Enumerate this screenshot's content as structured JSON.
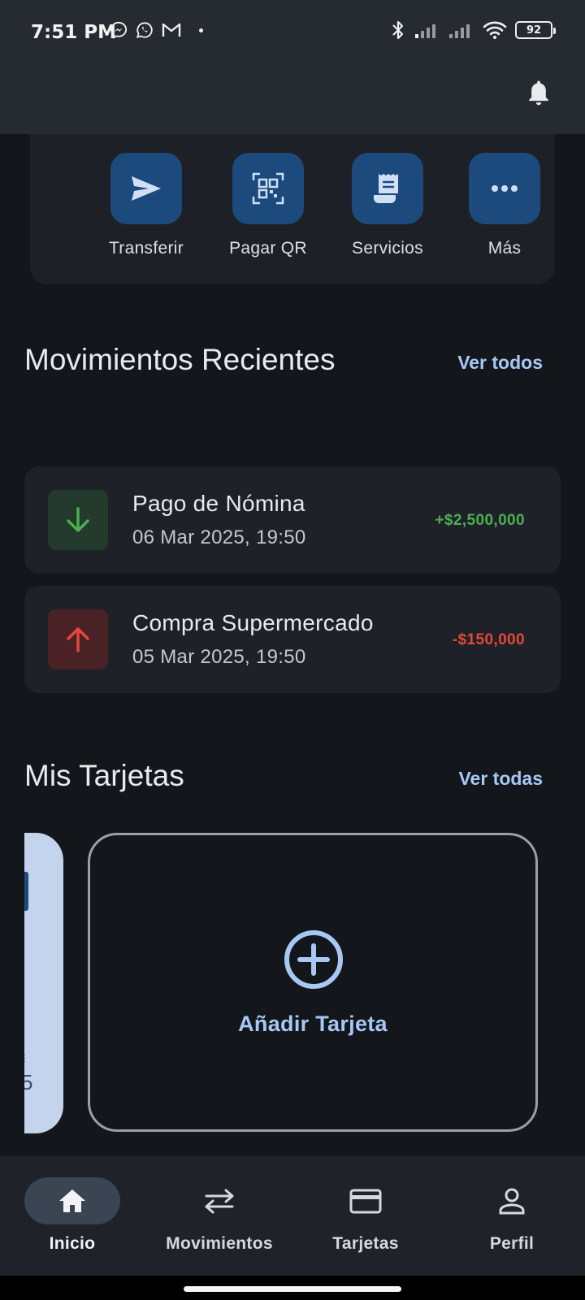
{
  "status_bar": {
    "time": "7:51 PM",
    "battery": "92",
    "notification_icons": [
      "messenger-icon",
      "whatsapp-icon",
      "gmail-icon",
      "dot-icon"
    ],
    "system_icons": [
      "bluetooth-icon",
      "signal-icon",
      "signal-icon",
      "wifi-icon",
      "battery-icon"
    ]
  },
  "header": {
    "bell_icon": "bell-icon"
  },
  "quick_actions": [
    {
      "label": "Transferir",
      "icon": "send-icon"
    },
    {
      "label": "Pagar QR",
      "icon": "qr-code-icon"
    },
    {
      "label": "Servicios",
      "icon": "receipt-icon"
    },
    {
      "label": "Más",
      "icon": "more-icon"
    }
  ],
  "recent_movements": {
    "title": "Movimientos Recientes",
    "see_all": "Ver todos",
    "items": [
      {
        "name": "Pago de Nómina",
        "date": "06 Mar 2025, 19:50",
        "amount": "+$2,500,000",
        "type": "income"
      },
      {
        "name": "Compra Supermercado",
        "date": "05 Mar 2025, 19:50",
        "amount": "-$150,000",
        "type": "expense"
      }
    ]
  },
  "my_cards": {
    "title": "Mis Tarjetas",
    "see_all": "Ver todas",
    "add_card_label": "Añadir Tarjeta",
    "peek_card_digit": "5"
  },
  "bottom_nav": [
    {
      "label": "Inicio",
      "icon": "home-icon",
      "active": true
    },
    {
      "label": "Movimientos",
      "icon": "swap-icon",
      "active": false
    },
    {
      "label": "Tarjetas",
      "icon": "credit-card-icon",
      "active": false
    },
    {
      "label": "Perfil",
      "icon": "person-icon",
      "active": false
    }
  ],
  "colors": {
    "background": "#13161b",
    "accent": "#a7c8f5",
    "income": "#4caf50",
    "expense": "#e5483b",
    "tile": "#1c4a7c"
  }
}
